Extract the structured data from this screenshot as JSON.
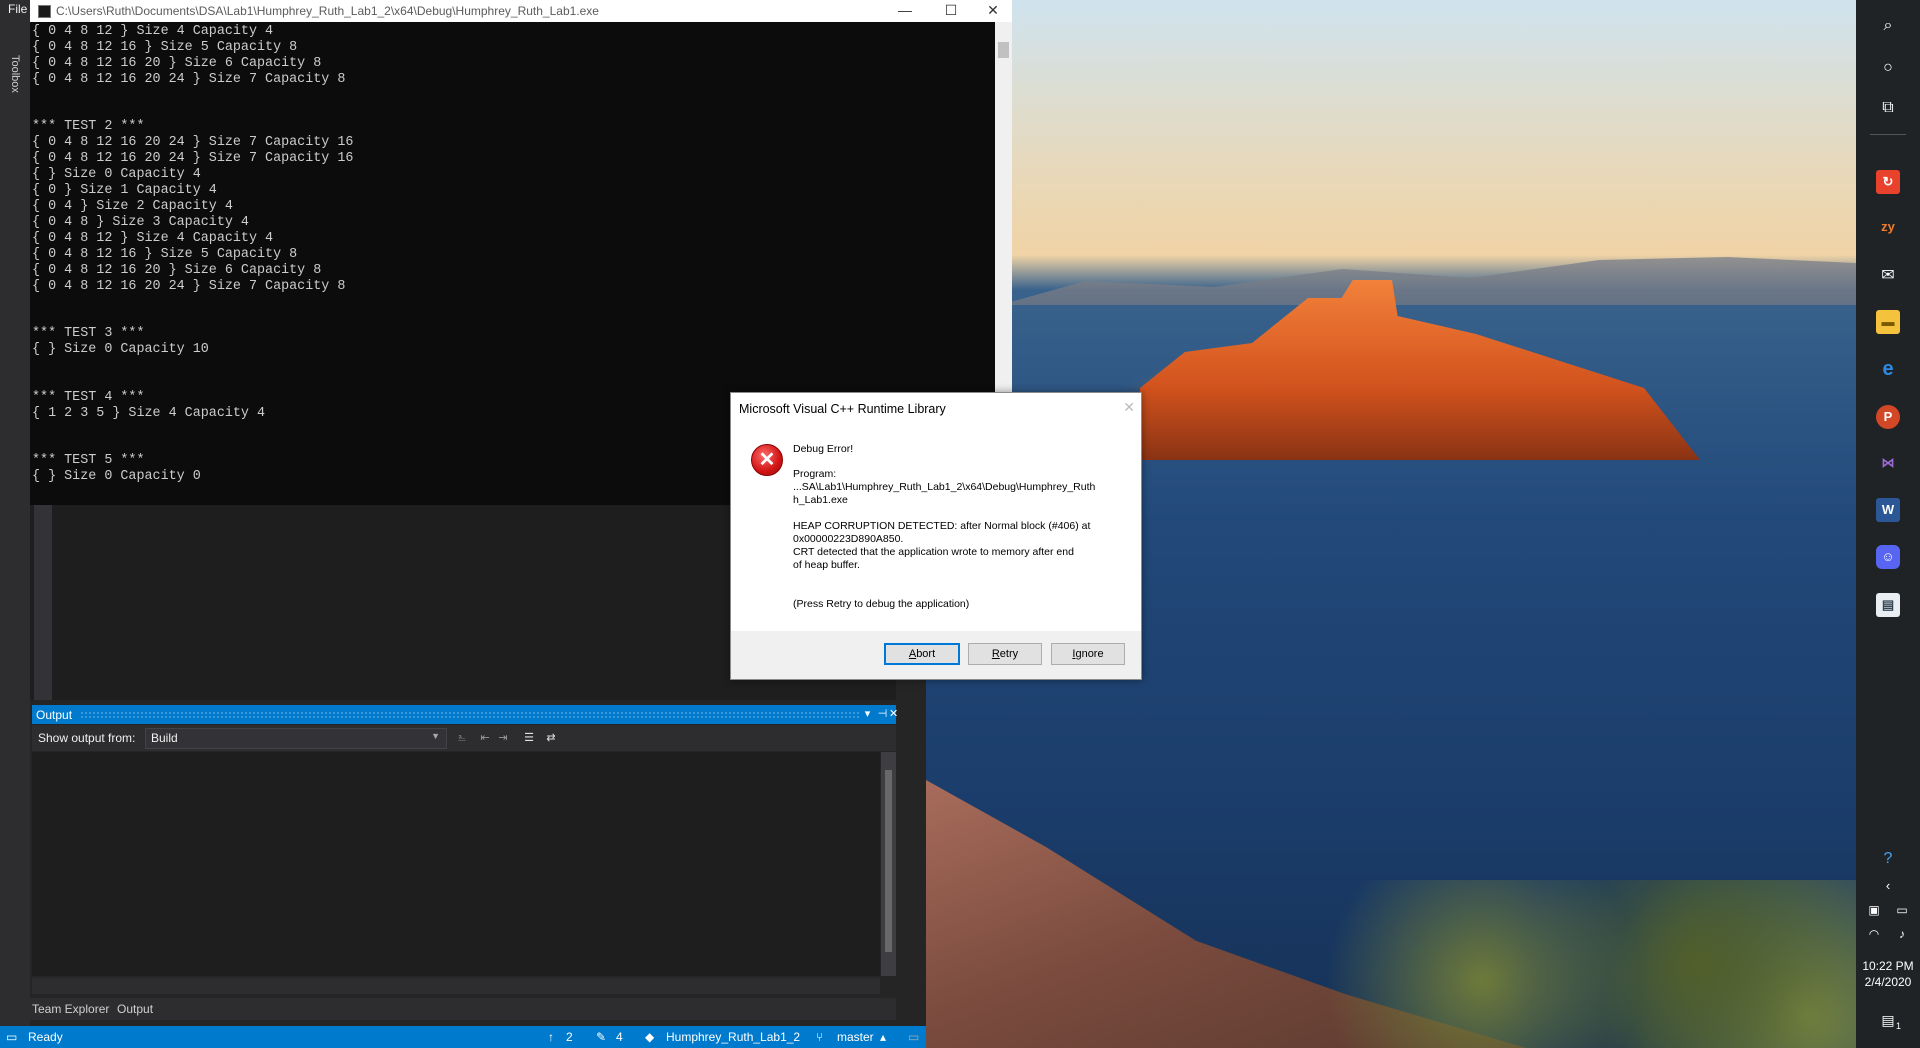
{
  "ide": {
    "file_menu": "File",
    "toolbox_label": "Toolbox",
    "output": {
      "title": "Output",
      "show_from_label": "Show output from:",
      "source_value": "Build"
    },
    "bottom_tabs": [
      "Team Explorer",
      "Output"
    ],
    "status": {
      "ready": "Ready",
      "push_count": "2",
      "changes_count": "4",
      "repo": "Humphrey_Ruth_Lab1_2",
      "branch": "master"
    }
  },
  "console": {
    "title": "C:\\Users\\Ruth\\Documents\\DSA\\Lab1\\Humphrey_Ruth_Lab1_2\\x64\\Debug\\Humphrey_Ruth_Lab1.exe",
    "lines": [
      "{ 0 4 8 12 } Size 4 Capacity 4",
      "{ 0 4 8 12 16 } Size 5 Capacity 8",
      "{ 0 4 8 12 16 20 } Size 6 Capacity 8",
      "{ 0 4 8 12 16 20 24 } Size 7 Capacity 8",
      "",
      "",
      "*** TEST 2 ***",
      "{ 0 4 8 12 16 20 24 } Size 7 Capacity 16",
      "{ 0 4 8 12 16 20 24 } Size 7 Capacity 16",
      "{ } Size 0 Capacity 4",
      "{ 0 } Size 1 Capacity 4",
      "{ 0 4 } Size 2 Capacity 4",
      "{ 0 4 8 } Size 3 Capacity 4",
      "{ 0 4 8 12 } Size 4 Capacity 4",
      "{ 0 4 8 12 16 } Size 5 Capacity 8",
      "{ 0 4 8 12 16 20 } Size 6 Capacity 8",
      "{ 0 4 8 12 16 20 24 } Size 7 Capacity 8",
      "",
      "",
      "*** TEST 3 ***",
      "{ } Size 0 Capacity 10",
      "",
      "",
      "*** TEST 4 ***",
      "{ 1 2 3 5 } Size 4 Capacity 4",
      "",
      "",
      "*** TEST 5 ***",
      "{ } Size 0 Capacity 0"
    ]
  },
  "dialog": {
    "title": "Microsoft Visual C++ Runtime Library",
    "heading": "Debug Error!",
    "program_label": "Program:",
    "program_path": "...SA\\Lab1\\Humphrey_Ruth_Lab1_2\\x64\\Debug\\Humphrey_Ruth_Lab1.exe",
    "program_path_line1": "...SA\\Lab1\\Humphrey_Ruth_Lab1_2\\x64\\Debug\\Humphrey_Ruth",
    "program_path_line2": "h_Lab1.exe",
    "message_line1": "HEAP CORRUPTION DETECTED: after Normal block (#406) at",
    "message_line2": "0x00000223D890A850.",
    "message_line3": "CRT detected that the application wrote to memory after end",
    "message_line4": "of heap buffer.",
    "hint": "(Press Retry to debug the application)",
    "buttons": {
      "abort": "Abort",
      "retry": "Retry",
      "ignore": "Ignore"
    }
  },
  "taskbar": {
    "time": "10:22 PM",
    "date": "2/4/2020",
    "notification_count": "1",
    "icons": [
      "search-icon",
      "cortana-icon",
      "task-view-icon",
      "snagit-icon",
      "zybooks-icon",
      "mail-icon",
      "file-explorer-icon",
      "edge-icon",
      "powerpoint-icon",
      "visual-studio-icon",
      "word-icon",
      "discord-icon",
      "app-icon"
    ]
  }
}
